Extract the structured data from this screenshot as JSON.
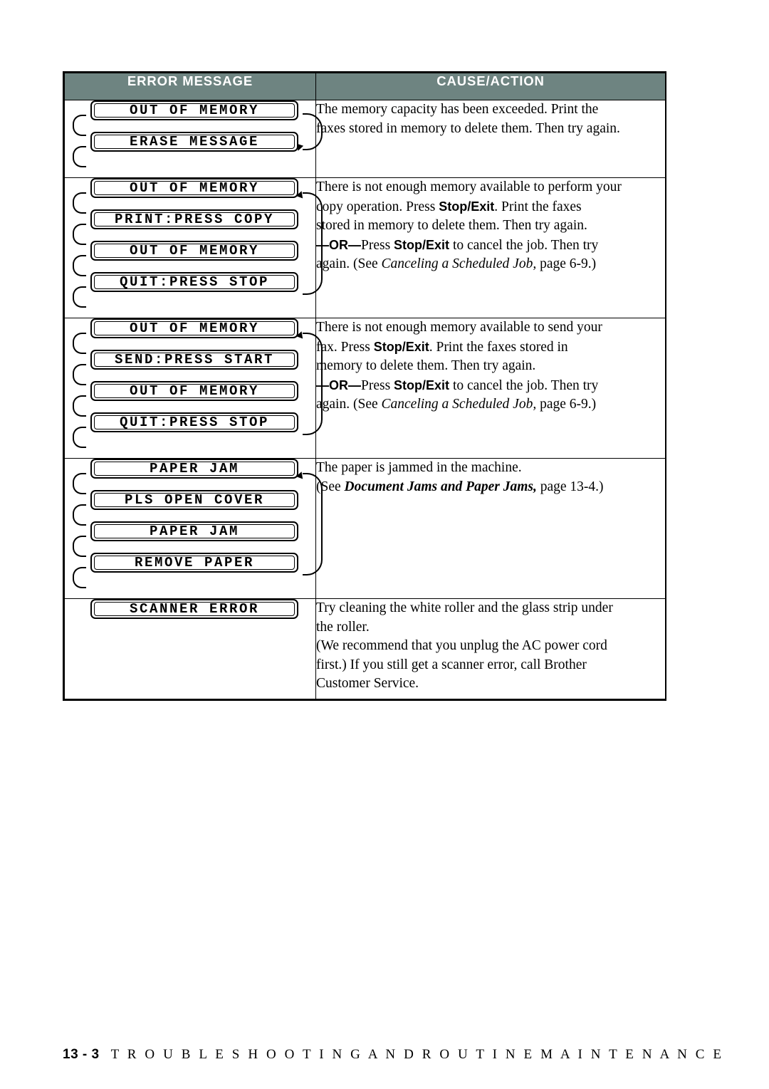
{
  "table": {
    "headers": [
      "ERROR MESSAGE",
      "CAUSE/ACTION"
    ],
    "rows": [
      {
        "messages": [
          "OUT OF MEMORY",
          "ERASE MESSAGE"
        ],
        "cause_lines": [
          "The memory capacity has been exceeded. Print the",
          "faxes stored in memory to delete them. Then try again."
        ]
      },
      {
        "messages": [
          "OUT OF MEMORY",
          "PRINT:PRESS COPY",
          "OUT OF MEMORY",
          "QUIT:PRESS STOP"
        ],
        "cause_parts": {
          "p1_a": "There is not enough memory available to perform your",
          "p1_b": "copy operation. Press ",
          "p1_bold": "Stop/Exit",
          "p1_c": ". Print the faxes",
          "p1_d": "stored in memory to delete them. Then try again.",
          "or_dash": "—OR—",
          "or_press": "Press ",
          "or_bold": "Stop/Exit",
          "or_tail": " to cancel the job. Then try",
          "see_pre": "again. (See ",
          "see_ital": "Canceling a Scheduled Job,",
          "see_post": " page 6-9.)"
        }
      },
      {
        "messages": [
          "OUT OF MEMORY",
          "SEND:PRESS START",
          "OUT OF MEMORY",
          "QUIT:PRESS STOP"
        ],
        "cause_parts": {
          "p1_a": "There is not enough memory available to send your",
          "p1_b": "fax. Press ",
          "p1_bold": "Stop/Exit",
          "p1_c": ". Print the faxes stored in",
          "p1_d": "memory to delete them. Then try again.",
          "or_dash": "—OR—",
          "or_press": "Press ",
          "or_bold": "Stop/Exit",
          "or_tail": " to cancel the job. Then try",
          "see_pre": "again. (See ",
          "see_ital": "Canceling a Scheduled Job,",
          "see_post": " page 6-9.)"
        }
      },
      {
        "messages": [
          "PAPER JAM",
          "PLS OPEN COVER",
          "PAPER JAM",
          "REMOVE PAPER"
        ],
        "cause_parts": {
          "line1": "The paper is jammed in the machine.",
          "see_pre": "(See ",
          "see_ital": "Document Jams and Paper Jams,",
          "see_post": " page 13-4.)"
        }
      },
      {
        "messages": [
          "SCANNER ERROR"
        ],
        "cause_lines": [
          "Try cleaning the white roller and the glass strip under",
          "the roller.",
          "(We recommend that you unplug the AC power cord",
          "first.) If you still get a scanner error, call Brother",
          "Customer Service."
        ]
      }
    ]
  },
  "footer": {
    "page": "13 - 3",
    "caption": "T R O U B L E S H O O T I N G   A N D   R O U T I N E   M A I N T E N A N C E"
  },
  "colors": {
    "header_bg": "#6e8481",
    "header_text": "#ffffff",
    "border": "#000000"
  }
}
